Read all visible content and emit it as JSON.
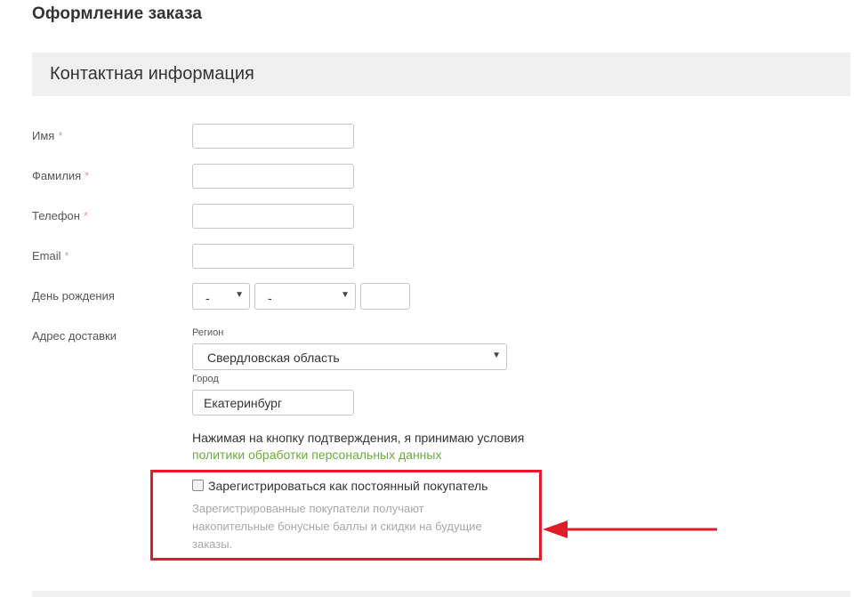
{
  "page": {
    "title": "Оформление заказа"
  },
  "section": {
    "title": "Контактная информация"
  },
  "form": {
    "required_mark": "*",
    "name_label": "Имя",
    "surname_label": "Фамилия",
    "phone_label": "Телефон",
    "email_label": "Email",
    "birthday_label": "День рождения",
    "birthday_day": "-",
    "birthday_month": "-",
    "birthday_year": "",
    "address_label": "Адрес доставки",
    "region_label": "Регион",
    "region_value": "Свердловская область",
    "city_label": "Город",
    "city_value": "Екатеринбург"
  },
  "consent": {
    "text": "Нажимая на кнопку подтверждения, я принимаю условия ",
    "link": "политики обработки персональных данных"
  },
  "register": {
    "checked": false,
    "label": "Зарегистрироваться как постоянный покупатель",
    "note": "Зарегистрированные покупатели получают накопительные бонусные баллы и скидки на будущие заказы."
  },
  "colors": {
    "annotation": "#e21b2a",
    "link": "#6aab3c",
    "section_bg": "#f0f0f0"
  }
}
